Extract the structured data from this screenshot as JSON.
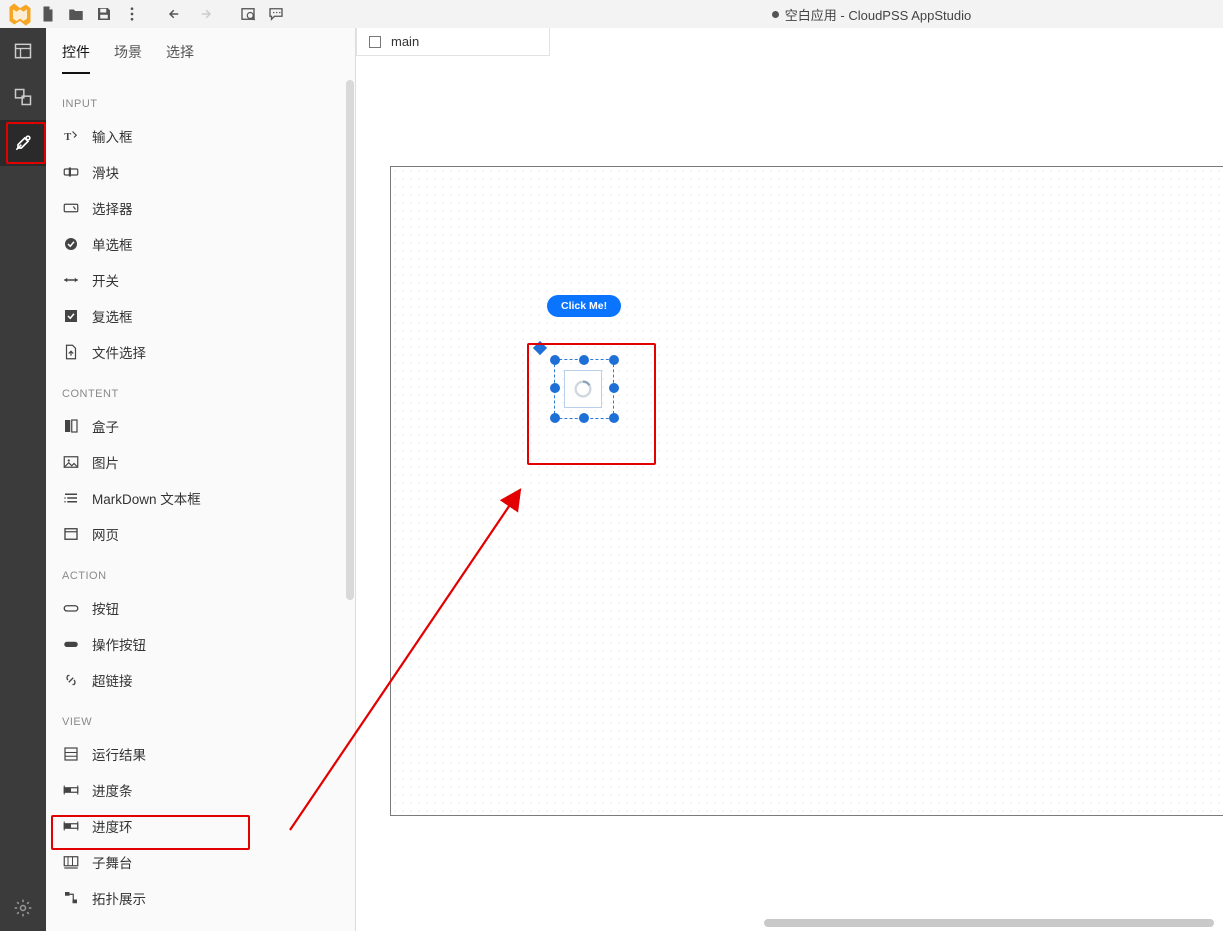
{
  "app_title": "空白应用 - CloudPSS AppStudio",
  "tabs": {
    "widgets": "控件",
    "scenes": "场景",
    "selection": "选择"
  },
  "groups": {
    "input": "INPUT",
    "content": "CONTENT",
    "action": "ACTION",
    "view": "VIEW"
  },
  "widgets": {
    "input_box": "输入框",
    "slider": "滑块",
    "selector": "选择器",
    "radio": "单选框",
    "switch": "开关",
    "checkbox": "复选框",
    "file_select": "文件选择",
    "box": "盒子",
    "image": "图片",
    "markdown": "MarkDown 文本框",
    "web": "网页",
    "button": "按钮",
    "action_button": "操作按钮",
    "hyperlink": "超链接",
    "run_result": "运行结果",
    "progress_bar": "进度条",
    "progress_ring": "进度环",
    "sub_stage": "子舞台",
    "topology": "拓扑展示"
  },
  "doc_tab": "main",
  "canvas": {
    "button_label": "Click Me!"
  }
}
